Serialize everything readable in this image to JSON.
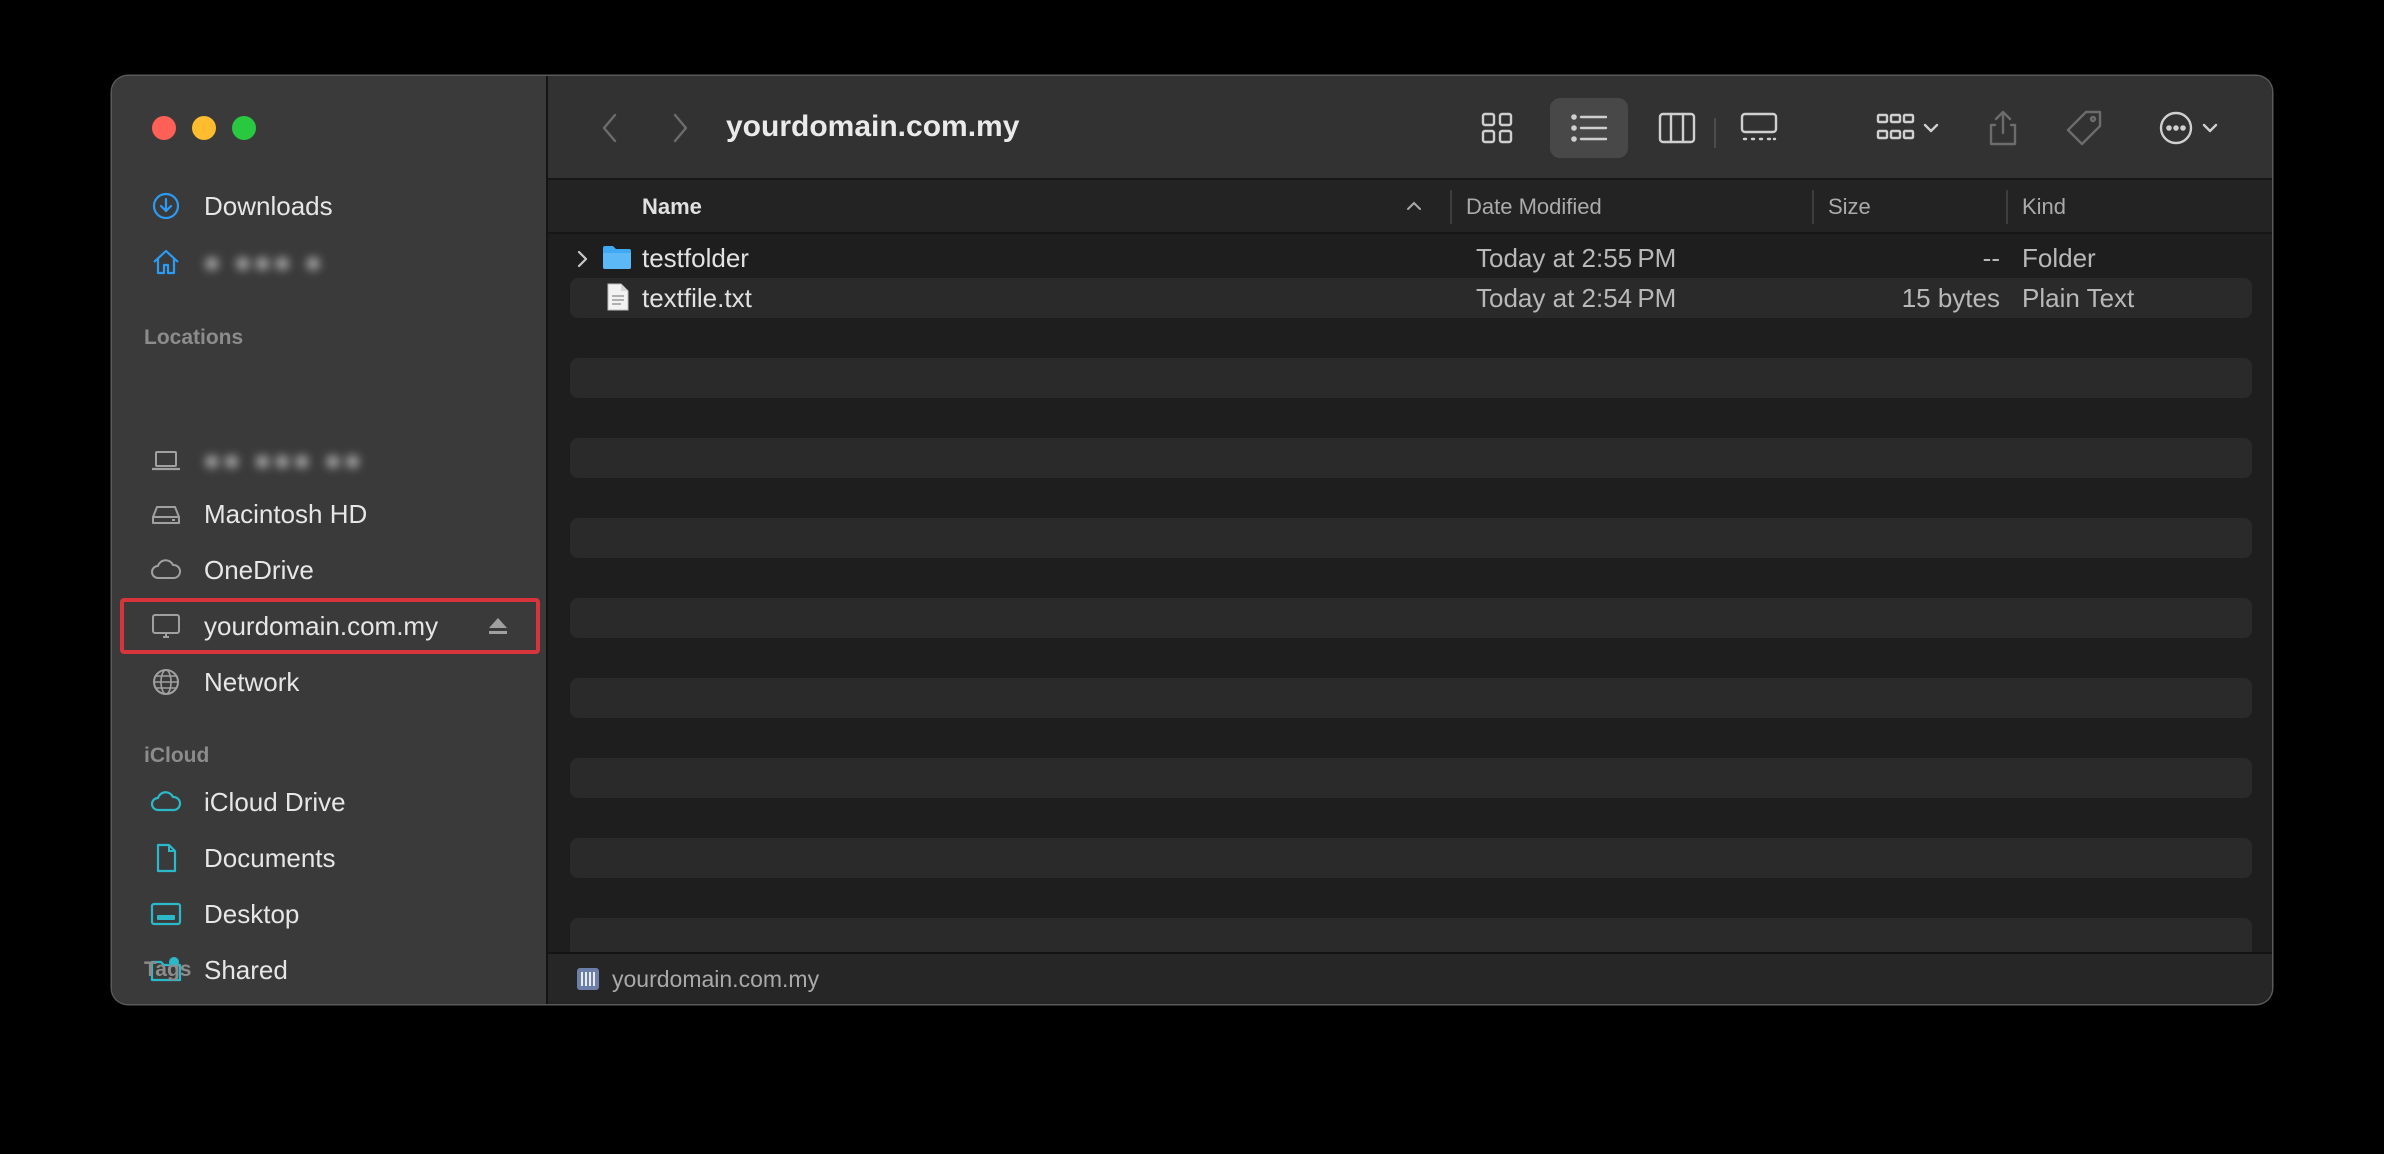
{
  "window": {
    "title": "yourdomain.com.my"
  },
  "sidebar": {
    "favorites": [
      {
        "label": "Downloads",
        "icon": "download-icon"
      },
      {
        "label": "● ●●● ●",
        "icon": "home-icon",
        "redacted": true
      }
    ],
    "locations_heading": "Locations",
    "locations": [
      {
        "label": "●● ●●● ●●",
        "icon": "laptop-icon",
        "redacted": true
      },
      {
        "label": "Macintosh HD",
        "icon": "internal-drive-icon"
      },
      {
        "label": "OneDrive",
        "icon": "cloud-icon"
      },
      {
        "label": "yourdomain.com.my",
        "icon": "server-display-icon",
        "selected_highlight": true
      },
      {
        "label": "Network",
        "icon": "globe-icon"
      }
    ],
    "icloud_heading": "iCloud",
    "icloud": [
      {
        "label": "iCloud Drive",
        "icon": "icloud-icon"
      },
      {
        "label": "Documents",
        "icon": "document-icon"
      },
      {
        "label": "Desktop",
        "icon": "desktop-icon"
      },
      {
        "label": "Shared",
        "icon": "shared-folder-icon"
      }
    ],
    "tags_heading": "Tags"
  },
  "columns": {
    "name": "Name",
    "date": "Date Modified",
    "size": "Size",
    "kind": "Kind"
  },
  "files": [
    {
      "name": "testfolder",
      "date": "Today at 2:55 PM",
      "size": "--",
      "kind": "Folder",
      "icon": "folder-icon",
      "expandable": true
    },
    {
      "name": "textfile.txt",
      "date": "Today at 2:54 PM",
      "size": "15 bytes",
      "kind": "Plain Text",
      "icon": "text-file-icon",
      "expandable": false
    }
  ],
  "pathbar": {
    "label": "yourdomain.com.my",
    "icon": "server-icon"
  },
  "colors": {
    "accent_highlight": "#d8343b",
    "sidebar_icon": "#2b9bf4",
    "folder": "#3fa9f5"
  }
}
